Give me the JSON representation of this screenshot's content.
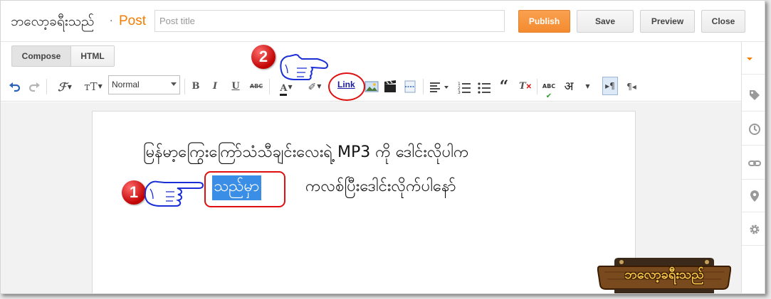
{
  "header": {
    "blog_name": "ဘလော့ခရီးသည်",
    "separator": "·",
    "post_label": "Post",
    "title_placeholder": "Post title",
    "publish_label": "Publish",
    "save_label": "Save",
    "preview_label": "Preview",
    "close_label": "Close"
  },
  "mode_tabs": {
    "compose_label": "Compose",
    "html_label": "HTML",
    "active": "Compose"
  },
  "toolbar": {
    "font_size_value": "Normal",
    "link_label": "Link",
    "icons": [
      "undo-icon",
      "redo-icon",
      "font-family-icon",
      "text-size-icon",
      "bold-icon",
      "italic-icon",
      "underline-icon",
      "strikethrough-icon",
      "text-color-icon",
      "highlight-icon",
      "link-icon",
      "image-icon",
      "video-icon",
      "jump-break-icon",
      "align-icon",
      "numbered-list-icon",
      "bullet-list-icon",
      "quote-icon",
      "clear-formatting-icon",
      "spellcheck-icon",
      "transliteration-icon",
      "ltr-icon",
      "rtl-icon"
    ],
    "colors": {
      "accent": "#f48b2f",
      "link": "#1a1aa6",
      "selection": "#3a8ee6"
    }
  },
  "sidebar": {
    "icons": [
      "post-settings-arrow-icon",
      "label-icon",
      "clock-icon",
      "link-icon",
      "location-icon",
      "gear-icon"
    ]
  },
  "editor": {
    "line1": "မြန်မာ့ကြွေးကြော်သံသီချင်းလေးရဲ့  MP3  ကို ဒေါင်းလိုပါက",
    "selected_text": "သည်မှာ",
    "line2_rest": "ကလစ်ပြီးဒေါင်းလိုက်ပါနော်"
  },
  "annotations": {
    "marker1": "1",
    "marker2": "2",
    "marker_color": "#e01010"
  },
  "logo": {
    "text": "ဘလော့ခရီးသည်"
  }
}
